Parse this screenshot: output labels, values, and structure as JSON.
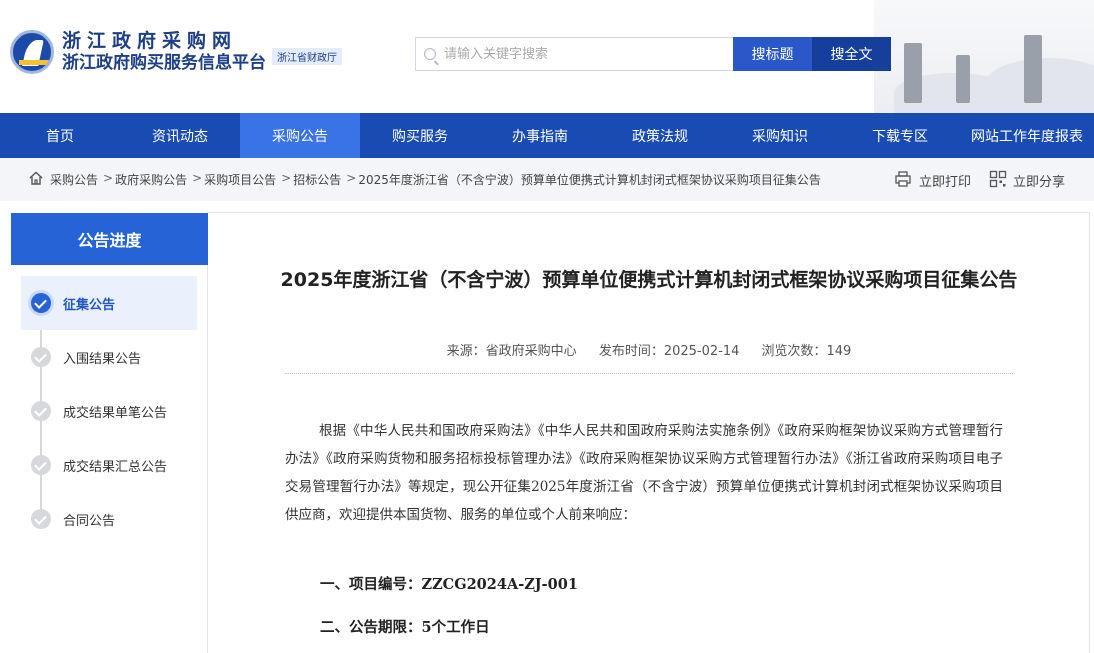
{
  "header": {
    "logo_line1": "浙江政府采购网",
    "logo_line2": "浙江政府购买服务信息平台",
    "logo_badge": "浙江省财政厅",
    "search_placeholder": "请输入关键字搜索",
    "search_title_label": "搜标题",
    "search_all_label": "搜全文"
  },
  "nav": {
    "items": [
      "首页",
      "资讯动态",
      "采购公告",
      "购买服务",
      "办事指南",
      "政策法规",
      "采购知识",
      "下载专区",
      "网站工作年度报表"
    ],
    "active_index": 2
  },
  "breadcrumb": {
    "items": [
      "采购公告",
      "政府采购公告",
      "采购项目公告",
      "招标公告",
      "2025年度浙江省（不含宁波）预算单位便携式计算机封闭式框架协议采购项目征集公告"
    ],
    "separator": ">",
    "print_label": "立即打印",
    "share_label": "立即分享"
  },
  "sidebar": {
    "title": "公告进度",
    "steps": [
      "征集公告",
      "入围结果公告",
      "成交结果单笔公告",
      "成交结果汇总公告",
      "合同公告"
    ],
    "active_index": 0
  },
  "article": {
    "title": "2025年度浙江省（不含宁波）预算单位便携式计算机封闭式框架协议采购项目征集公告",
    "source": "来源：省政府采购中心",
    "publish_time": "发布时间：2025-02-14",
    "views": "浏览次数：149",
    "body": "根据《中华人民共和国政府采购法》《中华人民共和国政府采购法实施条例》《政府采购框架协议采购方式管理暂行办法》《政府采购货物和服务招标投标管理办法》《政府采购框架协议采购方式管理暂行办法》《浙江省政府采购项目电子交易管理暂行办法》等规定，现公开征集2025年度浙江省（不含宁波）预算单位便携式计算机封闭式框架协议采购项目供应商，欢迎提供本国货物、服务的单位或个人前来响应：",
    "section1": "一、项目编号：ZZCG2024A-ZJ-001",
    "section2": "二、公告期限：5个工作日"
  },
  "colors": {
    "nav_bg": "#1a4bb2",
    "nav_active": "#3a73e6",
    "accent": "#2563d6"
  }
}
